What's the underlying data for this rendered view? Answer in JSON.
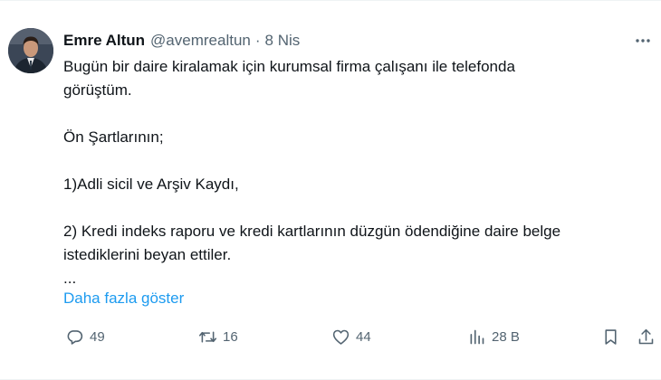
{
  "author": {
    "name": "Emre Altun",
    "handle": "@avemrealtun",
    "separator": "·",
    "date": "8 Nis"
  },
  "tweet": {
    "lines": [
      "Bugün bir daire kiralamak için kurumsal firma çalışanı ile telefonda",
      "görüştüm.",
      "",
      "Ön Şartlarının;",
      "",
      "1)Adli sicil ve Arşiv Kaydı,",
      "",
      "2) Kredi indeks raporu ve kredi kartlarının düzgün ödendiğine daire belge",
      "istediklerini beyan ettiler.",
      "..."
    ],
    "show_more": "Daha fazla göster"
  },
  "actions": {
    "replies": "49",
    "retweets": "16",
    "likes": "44",
    "views": "28 B"
  },
  "icons": {
    "more": "more-horizontal-icon",
    "reply": "reply-icon",
    "retweet": "retweet-icon",
    "like": "heart-icon",
    "views": "views-icon",
    "bookmark": "bookmark-icon",
    "share": "share-icon"
  },
  "colors": {
    "text": "#0f1419",
    "secondary": "#536471",
    "link": "#1d9bf0"
  }
}
